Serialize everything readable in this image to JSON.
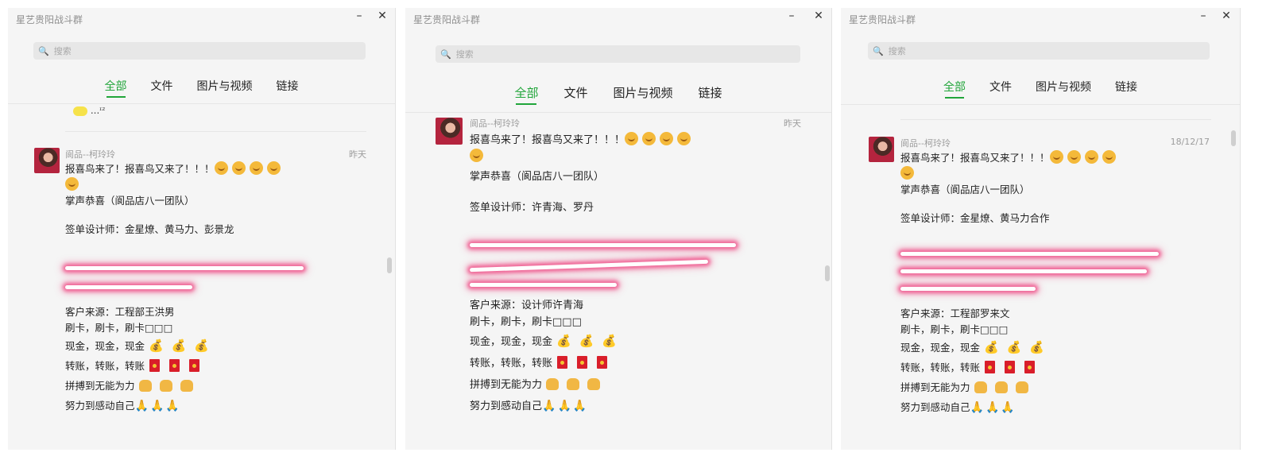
{
  "window": {
    "title": "星艺贵阳战斗群",
    "minimize_label": "–",
    "close_label": "✕"
  },
  "search": {
    "placeholder": "搜索"
  },
  "tabs": [
    {
      "label": "全部",
      "active": true
    },
    {
      "label": "文件",
      "active": false
    },
    {
      "label": "图片与视频",
      "active": false
    },
    {
      "label": "链接",
      "active": false
    }
  ],
  "panels": [
    {
      "title": "星艺贵阳战斗群",
      "partial_label": "...ᶦᶻ",
      "message": {
        "sender": "阆品--柯玲玲",
        "date": "昨天",
        "line1": "报喜鸟来了！报喜鸟又来了！！！",
        "line2": "掌声恭喜（阆品店八一团队）",
        "line3": "签单设计师：金星燎、黄马力、彭景龙",
        "source": "客户来源：工程部王洪男",
        "card": "刷卡，刷卡，刷卡□□□",
        "cash": "现金，现金，现金",
        "transfer": "转账，转账，转账",
        "fight": "拼搏到无能为力",
        "effort": "努力到感动自己"
      }
    },
    {
      "title": "星艺贵阳战斗群",
      "message": {
        "sender": "阆品--柯玲玲",
        "date": "昨天",
        "line1": "报喜鸟来了！报喜鸟又来了！！！",
        "line2": "掌声恭喜（阆品店八一团队）",
        "line3": "签单设计师：许青海、罗丹",
        "source": "客户来源：设计师许青海",
        "card": "刷卡，刷卡，刷卡□□□",
        "cash": "现金，现金，现金",
        "transfer": "转账，转账，转账",
        "fight": "拼搏到无能为力",
        "effort": "努力到感动自己"
      }
    },
    {
      "title": "星艺贵阳战斗群",
      "message": {
        "sender": "阆品--柯玲玲",
        "date": "18/12/17",
        "line1": "报喜鸟来了！报喜鸟又来了！！！",
        "line2": "掌声恭喜（阆品店八一团队）",
        "line3": "签单设计师：金星燎、黄马力合作",
        "source": "客户来源：工程部罗来文",
        "card": "刷卡，刷卡，刷卡□□□",
        "cash": "现金，现金，现金",
        "transfer": "转账，转账，转账",
        "fight": "拼搏到无能为力",
        "effort": "努力到感动自己"
      }
    }
  ],
  "icons": {
    "search": "🔍",
    "moneybag": "💰",
    "pray": "🙏"
  },
  "colors": {
    "accent": "#21a53a",
    "scribble": "#ef4682",
    "panel_bg": "#f5f5f5"
  }
}
